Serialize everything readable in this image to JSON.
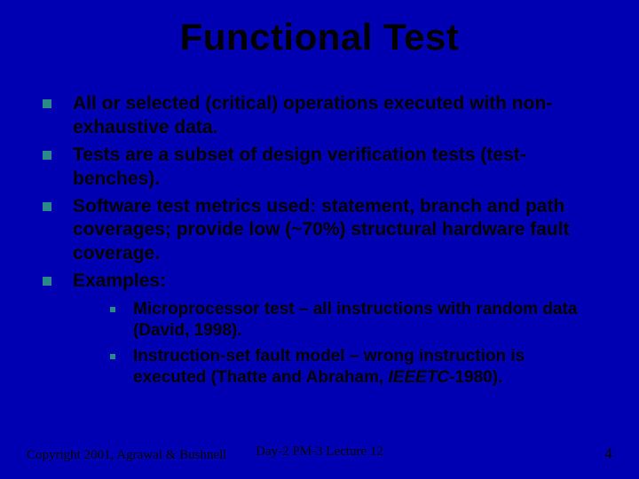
{
  "title": "Functional Test",
  "bullets": [
    "All or selected (critical) operations executed with non-exhaustive data.",
    "Tests are a subset of design verification tests (test-benches).",
    "Software test metrics used: statement, branch and path coverages; provide low (~70%) structural hardware fault coverage.",
    "Examples:"
  ],
  "sub_bullets": [
    {
      "plain": "Microprocessor test – all instructions with random data (David, 1998)."
    },
    {
      "plain": "Instruction-set fault model – wrong instruction is executed (Thatte and Abraham, ",
      "italic": "IEEETC",
      "after": "-1980)."
    }
  ],
  "footer": {
    "left": "Copyright 2001, Agrawal & Bushnell",
    "center": "Day-2 PM-3 Lecture 12",
    "right": "4"
  }
}
